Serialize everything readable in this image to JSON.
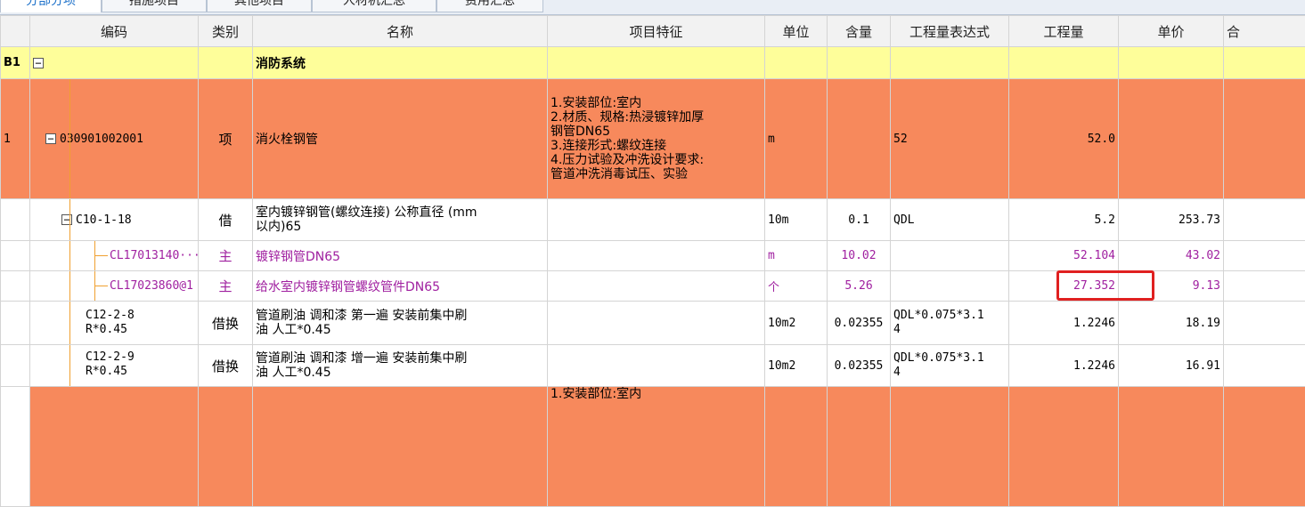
{
  "tabs": [
    "分部分项",
    "措施项目",
    "其他项目",
    "人材机汇总",
    "费用汇总"
  ],
  "columns": {
    "code": "编码",
    "category": "类别",
    "name": "名称",
    "feature": "项目特征",
    "unit": "单位",
    "content": "含量",
    "expr": "工程量表达式",
    "qty": "工程量",
    "price": "单价",
    "total": "合"
  },
  "rows": {
    "b1": {
      "rownum": "B1",
      "name": "消防系统"
    },
    "item1": {
      "rownum": "1",
      "code": "030901002001",
      "category": "项",
      "name": "消火栓钢管",
      "feature": [
        "1.安装部位:室内",
        "2.材质、规格:热浸镀锌加厚",
        "钢管DN65",
        "3.连接形式:螺纹连接",
        "4.压力试验及冲洗设计要求:",
        "管道冲洗消毒试压、实验"
      ],
      "unit": "m",
      "expr": "52",
      "qty": "52.0"
    },
    "sub1": {
      "code": "C10-1-18",
      "category": "借",
      "name": [
        "室内镀锌钢管(螺纹连接) 公称直径 (mm",
        "以内)65"
      ],
      "unit": "10m",
      "content": "0.1",
      "expr": "QDL",
      "qty": "5.2",
      "price": "253.73"
    },
    "mat1": {
      "code": "CL17013140···",
      "category": "主",
      "name": "镀锌钢管DN65",
      "unit": "m",
      "content": "10.02",
      "qty": "52.104",
      "price": "43.02"
    },
    "mat2": {
      "code": "CL17023860@1",
      "category": "主",
      "name": "给水室内镀锌钢管螺纹管件DN65",
      "unit": "个",
      "content": "5.26",
      "qty": "27.352",
      "price": "9.13"
    },
    "sub2": {
      "code": [
        "C12-2-8",
        "R*0.45"
      ],
      "category": "借换",
      "name": [
        "管道刷油 调和漆 第一遍  安装前集中刷",
        "油 人工*0.45"
      ],
      "unit": "10m2",
      "content": "0.02355",
      "expr": [
        "QDL*0.075*3.1",
        "4"
      ],
      "qty": "1.2246",
      "price": "18.19"
    },
    "sub3": {
      "code": [
        "C12-2-9",
        "R*0.45"
      ],
      "category": "借换",
      "name": [
        "管道刷油 调和漆 增一遍  安装前集中刷",
        "油 人工*0.45"
      ],
      "unit": "10m2",
      "content": "0.02355",
      "expr": [
        "QDL*0.075*3.1",
        "4"
      ],
      "qty": "1.2246",
      "price": "16.91"
    },
    "item2": {
      "feature": [
        "1.安装部位:室内"
      ]
    }
  },
  "colors": {
    "item_row": "#f7895c",
    "group_row": "#fefe9a",
    "material_text": "#a020a0",
    "highlight": "#e02020"
  }
}
